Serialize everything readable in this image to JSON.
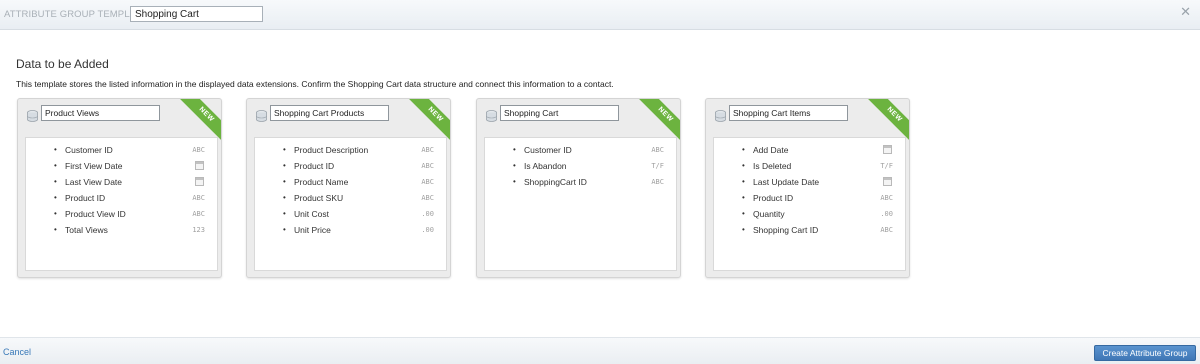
{
  "header": {
    "label": "ATTRIBUTE GROUP TEMPLATE",
    "name_value": "Shopping Cart",
    "close_icon": "close-icon"
  },
  "main": {
    "title": "Data to be Added",
    "description": "This template stores the listed information in the displayed data extensions. Confirm the Shopping Cart data structure and connect this information to a contact."
  },
  "cards": [
    {
      "name": "Product Views",
      "badge": "NEW",
      "fields": [
        {
          "label": "Customer ID",
          "type": "ABC"
        },
        {
          "label": "First View Date",
          "type": "date"
        },
        {
          "label": "Last View Date",
          "type": "date"
        },
        {
          "label": "Product ID",
          "type": "ABC"
        },
        {
          "label": "Product View ID",
          "type": "ABC"
        },
        {
          "label": "Total Views",
          "type": "123"
        }
      ]
    },
    {
      "name": "Shopping Cart Products",
      "badge": "NEW",
      "fields": [
        {
          "label": "Product Description",
          "type": "ABC"
        },
        {
          "label": "Product ID",
          "type": "ABC"
        },
        {
          "label": "Product Name",
          "type": "ABC"
        },
        {
          "label": "Product SKU",
          "type": "ABC"
        },
        {
          "label": "Unit Cost",
          "type": ".00"
        },
        {
          "label": "Unit Price",
          "type": ".00"
        }
      ]
    },
    {
      "name": "Shopping Cart",
      "badge": "NEW",
      "fields": [
        {
          "label": "Customer ID",
          "type": "ABC"
        },
        {
          "label": "Is Abandon",
          "type": "T/F"
        },
        {
          "label": "ShoppingCart ID",
          "type": "ABC"
        }
      ]
    },
    {
      "name": "Shopping Cart Items",
      "badge": "NEW",
      "fields": [
        {
          "label": "Add Date",
          "type": "date"
        },
        {
          "label": "Is Deleted",
          "type": "T/F"
        },
        {
          "label": "Last Update Date",
          "type": "date"
        },
        {
          "label": "Product ID",
          "type": "ABC"
        },
        {
          "label": "Quantity",
          "type": ".00"
        },
        {
          "label": "Shopping Cart ID",
          "type": "ABC"
        }
      ]
    }
  ],
  "footer": {
    "cancel_label": "Cancel",
    "create_label": "Create Attribute Group"
  },
  "colors": {
    "ribbon": "#6cb33f",
    "primary_button": "#3f77b6",
    "link": "#3979b8"
  }
}
